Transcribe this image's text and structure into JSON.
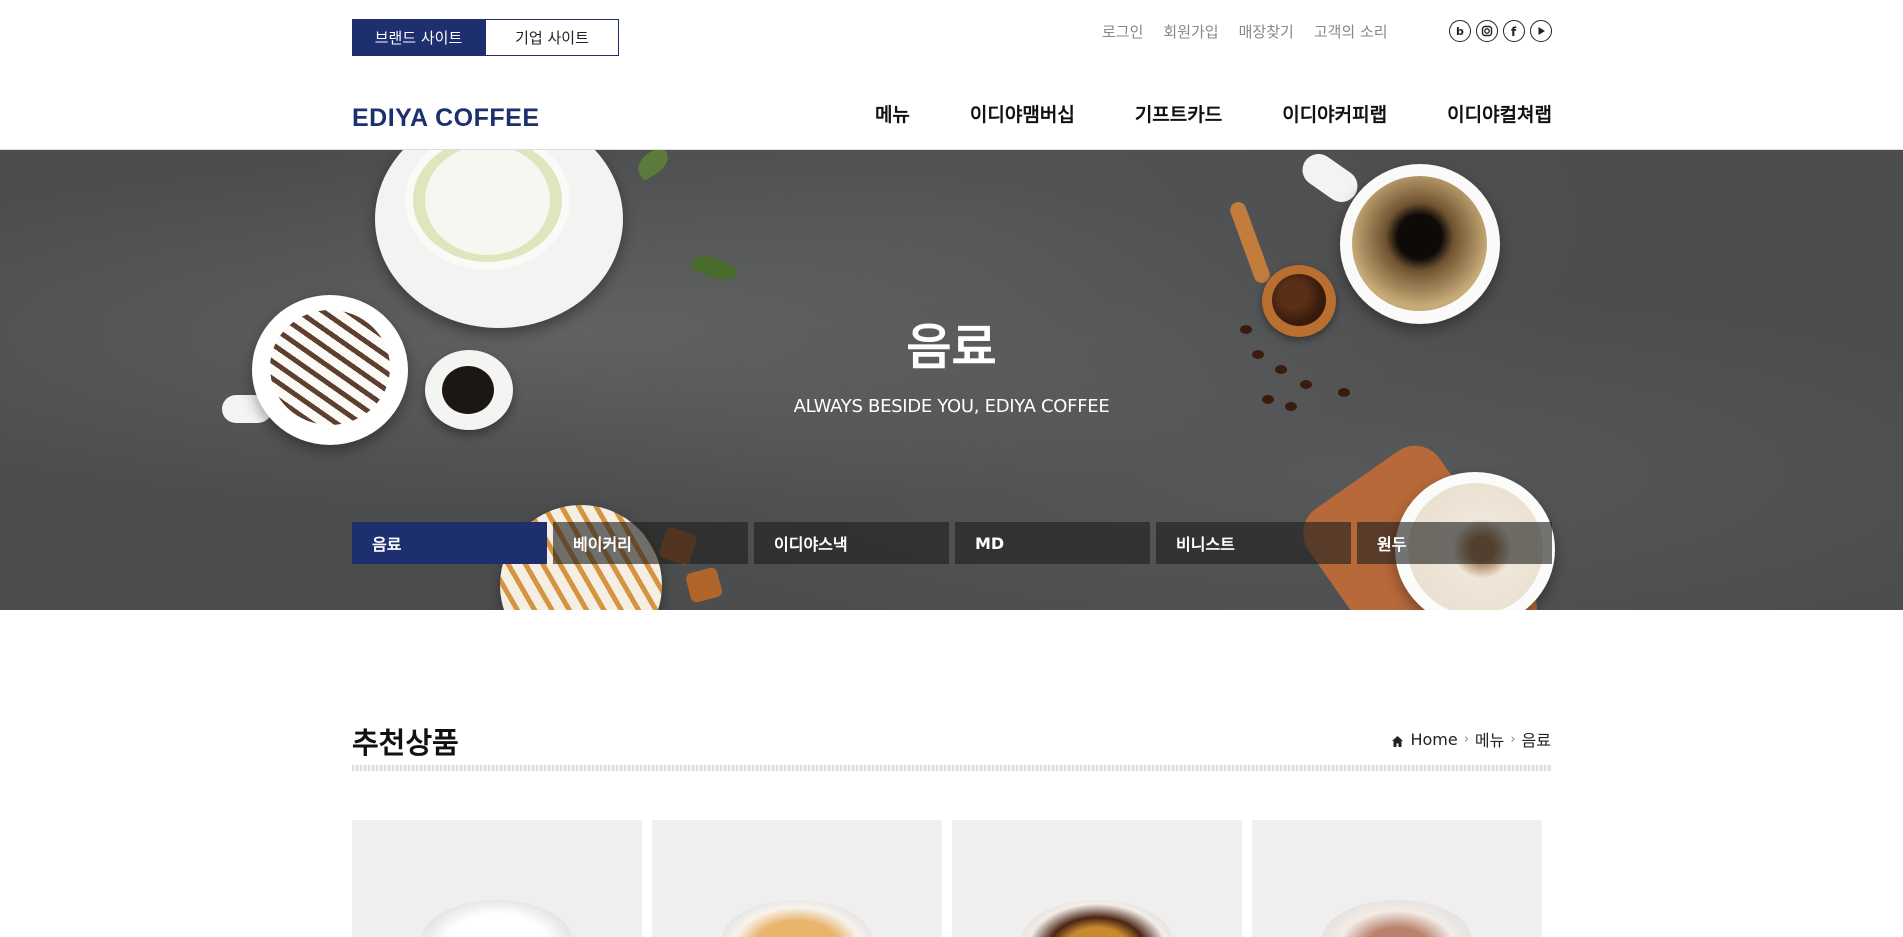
{
  "top_bar": {
    "site_tabs": [
      "브랜드 사이트",
      "기업 사이트"
    ],
    "util_links": [
      "로그인",
      "회원가입",
      "매장찾기",
      "고객의 소리"
    ],
    "sns_icons": [
      "blog-icon",
      "instagram-icon",
      "facebook-icon",
      "youtube-icon"
    ]
  },
  "header": {
    "logo": "EDIYA COFFEE",
    "nav": [
      "메뉴",
      "이디야맴버십",
      "기프트카드",
      "이디야커피랩",
      "이디야컬쳐랩"
    ]
  },
  "hero": {
    "title": "음료",
    "subtitle": "ALWAYS BESIDE YOU, EDIYA COFFEE"
  },
  "categories": [
    "음료",
    "베이커리",
    "이디야스낵",
    "MD",
    "비니스트",
    "원두"
  ],
  "section": {
    "title": "추천상품",
    "breadcrumb": [
      "Home",
      "메뉴",
      "음료"
    ]
  },
  "colors": {
    "brand": "#1d2f6f"
  }
}
